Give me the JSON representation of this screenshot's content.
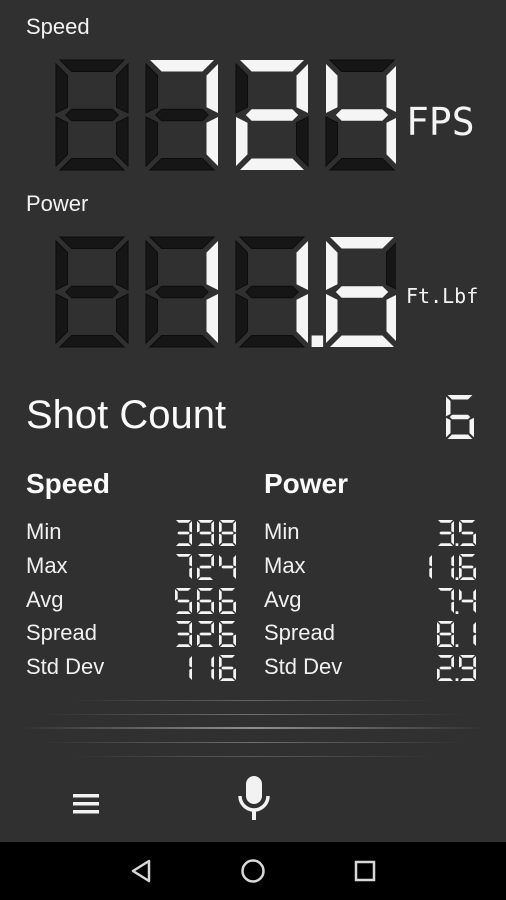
{
  "speed": {
    "label": "Speed",
    "value": "724",
    "unit": "FPS"
  },
  "power": {
    "label": "Power",
    "value": "11.6",
    "unit": "Ft.Lbf"
  },
  "shot_count": {
    "label": "Shot Count",
    "value": "6"
  },
  "stats": {
    "speed": {
      "title": "Speed",
      "rows": [
        {
          "label": "Min",
          "value": "398"
        },
        {
          "label": "Max",
          "value": "724"
        },
        {
          "label": "Avg",
          "value": "566"
        },
        {
          "label": "Spread",
          "value": "326"
        },
        {
          "label": "Std Dev",
          "value": "116"
        }
      ]
    },
    "power": {
      "title": "Power",
      "rows": [
        {
          "label": "Min",
          "value": "3.5"
        },
        {
          "label": "Max",
          "value": "11.6"
        },
        {
          "label": "Avg",
          "value": "7.4"
        },
        {
          "label": "Spread",
          "value": "8.1"
        },
        {
          "label": "Std Dev",
          "value": "2.9"
        }
      ]
    }
  },
  "icons": {
    "menu": "menu-icon",
    "mic": "microphone-icon",
    "back": "back-triangle-icon",
    "home": "home-circle-icon",
    "recents": "recents-square-icon"
  },
  "colors": {
    "background": "#303030",
    "segment_on": "#f5f5f5",
    "segment_off": "#161616",
    "nav_bar": "#000000"
  }
}
